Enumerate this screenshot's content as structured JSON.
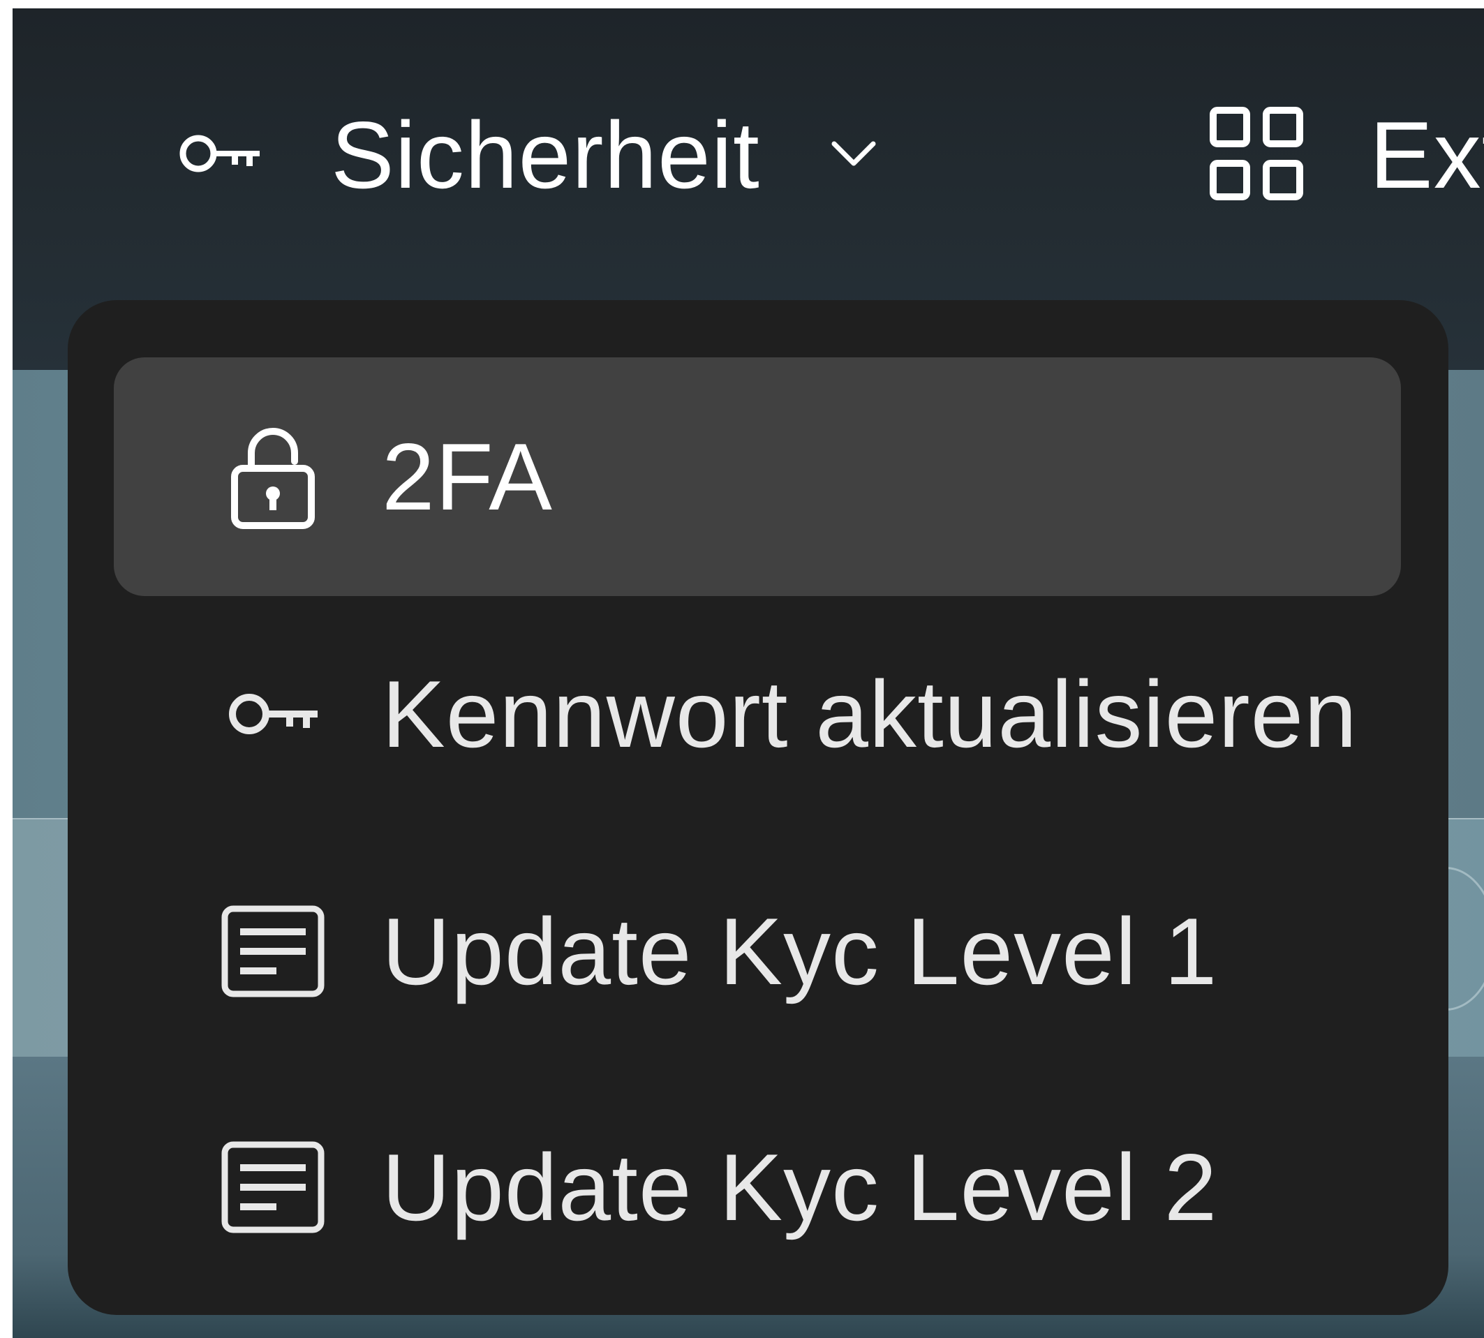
{
  "navbar": {
    "items": [
      {
        "label": "Sicherheit",
        "icon": "key-icon",
        "has_dropdown": true
      },
      {
        "label": "Ext",
        "icon": "grid-icon",
        "has_dropdown": false
      }
    ]
  },
  "security_menu": {
    "items": [
      {
        "label": "2FA",
        "icon": "lock-icon",
        "active": true
      },
      {
        "label": "Kennwort aktualisieren",
        "icon": "key-icon",
        "active": false
      },
      {
        "label": "Update Kyc Level 1",
        "icon": "document-icon",
        "active": false
      },
      {
        "label": "Update Kyc Level 2",
        "icon": "document-icon",
        "active": false
      }
    ]
  },
  "colors": {
    "navbar_bg": "#1e2429",
    "menu_bg": "#1f1f1f",
    "menu_item_active_bg": "#414141",
    "text": "#ffffff"
  }
}
